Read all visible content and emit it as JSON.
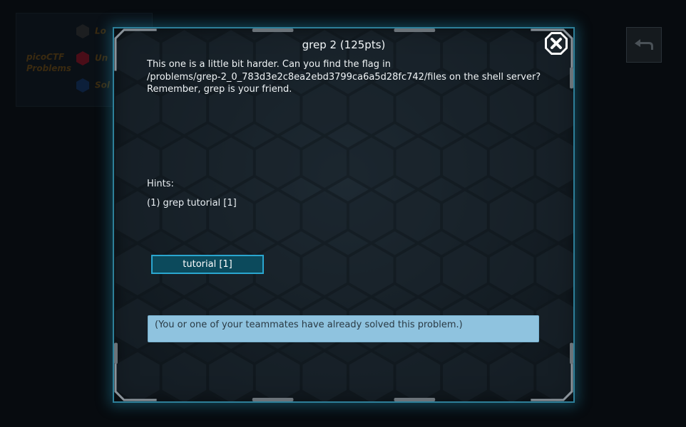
{
  "background": {
    "section_title": "picoCTF Problems",
    "legend": [
      {
        "label": "Lo",
        "color": "#1c1e20"
      },
      {
        "label": "Un",
        "color": "#4a0d18"
      },
      {
        "label": "Sol",
        "color": "#0c1f3a"
      }
    ]
  },
  "modal": {
    "title": "grep 2 (125pts)",
    "description": [
      "This one is a little bit harder. Can you find the flag in",
      "/problems/grep-2_0_783d3e2c8ea2ebd3799ca6a5d28fc742/files on the shell server?",
      "Remember, grep is your friend."
    ],
    "hints_label": "Hints:",
    "hints": [
      "(1) grep tutorial [1]"
    ],
    "tutorial_button": "tutorial [1]",
    "solved_message": "(You or one of your teammates have already solved this problem.)"
  },
  "icons": {
    "close": "close-icon",
    "back": "back-arrow-icon"
  },
  "colors": {
    "accent": "#2aa6cf",
    "solved_bg": "#8fc3df",
    "button_bg": "#0c4a5c"
  }
}
